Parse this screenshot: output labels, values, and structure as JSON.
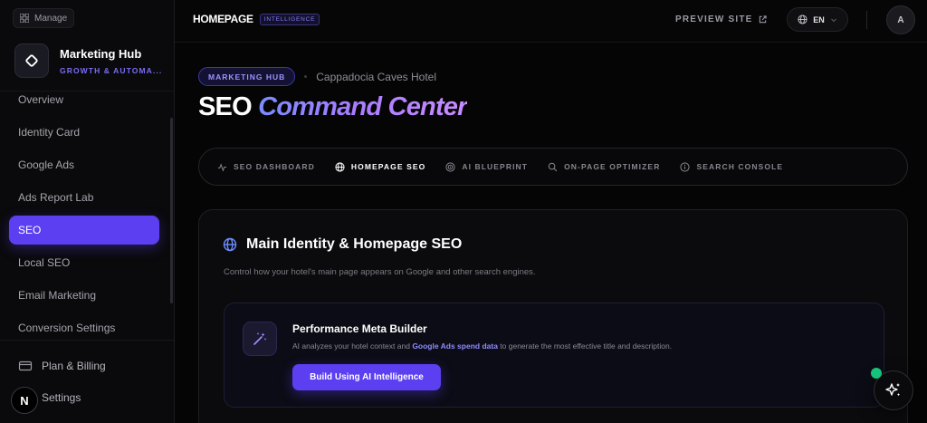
{
  "sidebar": {
    "manage_label": "Manage",
    "hub_title": "Marketing Hub",
    "hub_subtitle": "GROWTH & AUTOMA...",
    "items": [
      {
        "label": "Overview"
      },
      {
        "label": "Identity Card"
      },
      {
        "label": "Google Ads"
      },
      {
        "label": "Ads Report Lab"
      },
      {
        "label": "SEO",
        "active": true
      },
      {
        "label": "Local SEO"
      },
      {
        "label": "Email Marketing"
      },
      {
        "label": "Conversion Settings"
      }
    ],
    "bottom": {
      "billing": "Plan & Billing",
      "settings": "Settings",
      "badge": "N"
    }
  },
  "topbar": {
    "brand": "HOMEPAGE",
    "brand_tag": "INTELLIGENCE",
    "preview": "PREVIEW SITE",
    "lang": "EN",
    "avatar": "A"
  },
  "main": {
    "crumb_pill": "MARKETING HUB",
    "crumb_hotel": "Cappadocia Caves Hotel",
    "title_plain": "SEO ",
    "title_accent": "Command Center",
    "tabs": [
      {
        "label": "SEO DASHBOARD",
        "icon": "activity-icon"
      },
      {
        "label": "HOMEPAGE SEO",
        "icon": "globe-icon",
        "active": true
      },
      {
        "label": "AI BLUEPRINT",
        "icon": "target-icon"
      },
      {
        "label": "ON-PAGE OPTIMIZER",
        "icon": "search-icon"
      },
      {
        "label": "SEARCH CONSOLE",
        "icon": "info-icon"
      }
    ],
    "card": {
      "title": "Main Identity & Homepage SEO",
      "desc": "Control how your hotel's main page appears on Google and other search engines.",
      "builder": {
        "title": "Performance Meta Builder",
        "desc_pre": "AI analyzes your hotel context and ",
        "desc_hl": "Google Ads spend data",
        "desc_post": " to generate the most effective title and description.",
        "button": "Build Using AI Intelligence"
      }
    }
  },
  "colors": {
    "accent": "#5b3ff0",
    "status_online": "#17c27a"
  }
}
